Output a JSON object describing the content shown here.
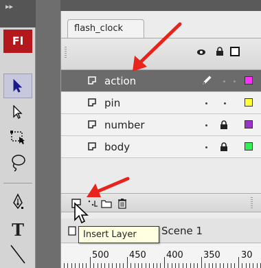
{
  "app": {
    "logo_text": "Fl"
  },
  "toolbar": {
    "tools": [
      {
        "name": "selection-tool",
        "icon": "arrow-icon",
        "selected": true
      },
      {
        "name": "subselection-tool",
        "icon": "white-arrow-icon",
        "selected": false
      },
      {
        "name": "free-transform-tool",
        "icon": "free-transform-icon",
        "selected": false
      },
      {
        "name": "lasso-tool",
        "icon": "lasso-icon",
        "selected": false
      },
      {
        "name": "pen-tool",
        "icon": "pen-icon",
        "selected": false
      },
      {
        "name": "text-tool",
        "icon": "text-icon",
        "selected": false
      },
      {
        "name": "line-tool",
        "icon": "line-icon",
        "selected": false
      }
    ],
    "text_tool_glyph": "T"
  },
  "document": {
    "tab_label": "flash_clock"
  },
  "timeline": {
    "header_icons": [
      "eye-icon",
      "lock-icon",
      "outline-icon"
    ],
    "layers": [
      {
        "name": "action",
        "selected": true,
        "show_pencil": true,
        "locked": false,
        "color": "#ff33ff"
      },
      {
        "name": "pin",
        "selected": false,
        "show_pencil": false,
        "locked": false,
        "color": "#ffff33"
      },
      {
        "name": "number",
        "selected": false,
        "show_pencil": false,
        "locked": true,
        "color": "#9933cc"
      },
      {
        "name": "body",
        "selected": false,
        "show_pencil": false,
        "locked": true,
        "color": "#33ee55"
      }
    ],
    "bottom_icons": [
      "new-layer-icon",
      "motion-guide-icon",
      "new-folder-icon",
      "trash-icon"
    ],
    "scene_label": "Scene 1",
    "ruler_labels": [
      "500",
      "450",
      "400",
      "350",
      "30"
    ]
  },
  "tooltip": {
    "text": "Insert Layer"
  },
  "annotation": {
    "arrow_color": "#e8231b"
  }
}
